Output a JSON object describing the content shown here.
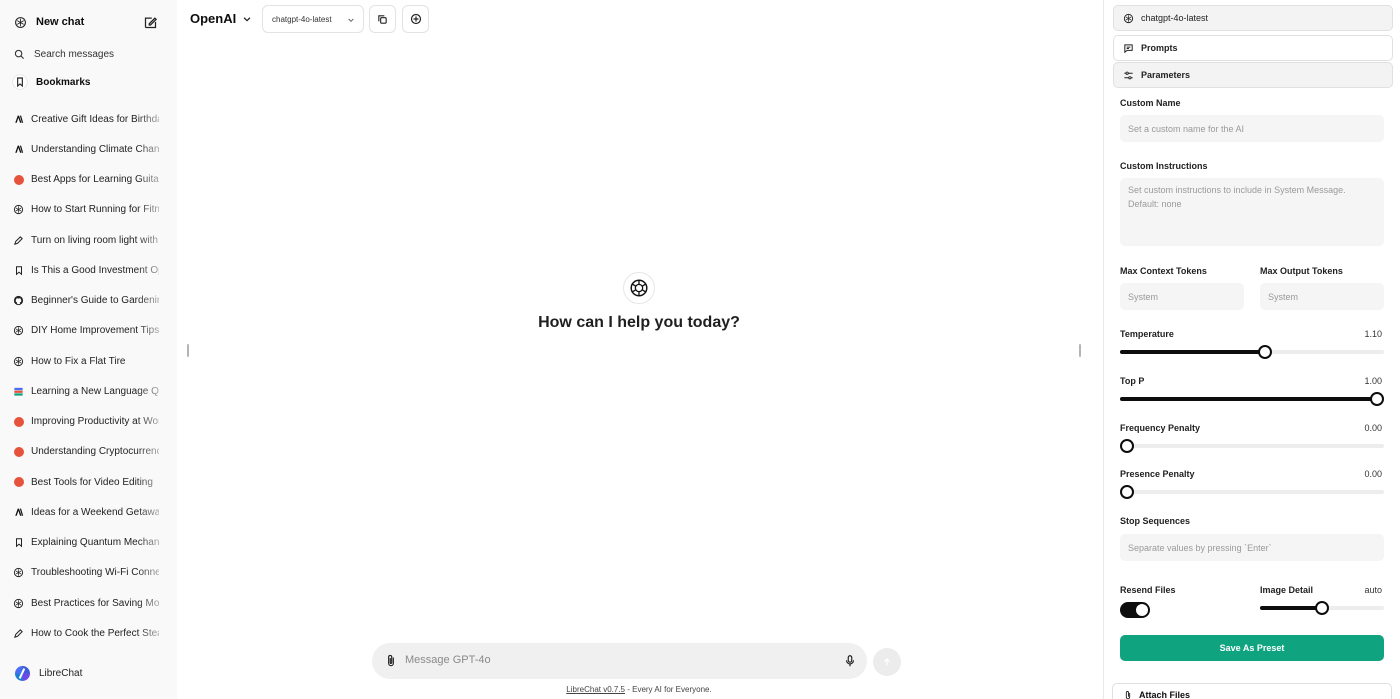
{
  "sidebar": {
    "new_chat": "New chat",
    "search_placeholder": "Search messages",
    "bookmarks": "Bookmarks",
    "conversations": [
      {
        "title": "Creative Gift Ideas for Birthdays",
        "icon": "anthropic-icon"
      },
      {
        "title": "Understanding Climate Change",
        "icon": "anthropic-icon"
      },
      {
        "title": "Best Apps for Learning Guitar",
        "icon": "red-dot-icon"
      },
      {
        "title": "How to Start Running for Fitness",
        "icon": "openai-icon"
      },
      {
        "title": "Turn on living room light with voice",
        "icon": "pencil-icon"
      },
      {
        "title": "Is This a Good Investment Opportunity",
        "icon": "bookmark-icon"
      },
      {
        "title": "Beginner's Guide to Gardening",
        "icon": "github-icon"
      },
      {
        "title": "DIY Home Improvement Tips",
        "icon": "openai-icon"
      },
      {
        "title": "How to Fix a Flat Tire",
        "icon": "openai-icon"
      },
      {
        "title": "Learning a New Language Quickly",
        "icon": "stack-icon"
      },
      {
        "title": "Improving Productivity at Work",
        "icon": "red-dot-icon"
      },
      {
        "title": "Understanding Cryptocurrency",
        "icon": "red-dot-icon"
      },
      {
        "title": "Best Tools for Video Editing",
        "icon": "red-dot-icon"
      },
      {
        "title": "Ideas for a Weekend Getaway",
        "icon": "anthropic-icon"
      },
      {
        "title": "Explaining Quantum Mechanics",
        "icon": "bookmark-icon"
      },
      {
        "title": "Troubleshooting Wi-Fi Connection",
        "icon": "openai-icon"
      },
      {
        "title": "Best Practices for Saving Money",
        "icon": "openai-icon"
      },
      {
        "title": "How to Cook the Perfect Steak",
        "icon": "pencil-icon"
      }
    ],
    "user_name": "LibreChat"
  },
  "header": {
    "endpoint": "OpenAI",
    "model": "chatgpt-4o-latest"
  },
  "main": {
    "greeting": "How can I help you today?",
    "input_placeholder": "Message GPT-4o",
    "footer_link": "LibreChat v0.7.5",
    "footer_text": " - Every AI for Everyone."
  },
  "panel": {
    "model": "chatgpt-4o-latest",
    "prompts": "Prompts",
    "parameters": "Parameters",
    "custom_name_label": "Custom Name",
    "custom_name_placeholder": "Set a custom name for the AI",
    "custom_instructions_label": "Custom Instructions",
    "custom_instructions_placeholder": "Set custom instructions to include in System Message. Default: none",
    "max_context_label": "Max Context Tokens",
    "max_context_placeholder": "System",
    "max_output_label": "Max Output Tokens",
    "max_output_placeholder": "System",
    "temperature": {
      "label": "Temperature",
      "value": "1.10"
    },
    "top_p": {
      "label": "Top P",
      "value": "1.00"
    },
    "frequency_penalty": {
      "label": "Frequency Penalty",
      "value": "0.00"
    },
    "presence_penalty": {
      "label": "Presence Penalty",
      "value": "0.00"
    },
    "stop_sequences_label": "Stop Sequences",
    "stop_sequences_placeholder": "Separate values by pressing `Enter`",
    "resend_files_label": "Resend Files",
    "image_detail": {
      "label": "Image Detail",
      "value": "auto"
    },
    "save_preset": "Save As Preset",
    "attach_files": "Attach Files"
  },
  "colors": {
    "accent": "#10a37f",
    "sidebar_bg": "#f9f9f9",
    "slider": "#0d0d0d"
  }
}
